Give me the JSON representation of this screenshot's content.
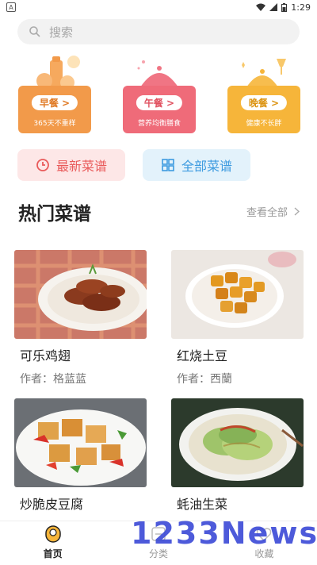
{
  "status_bar": {
    "time": "1:29",
    "left_icon": "A"
  },
  "search": {
    "placeholder": "搜索"
  },
  "meals": [
    {
      "label": "早餐 >",
      "subtitle": "365天不重样",
      "color": "#f29a4a"
    },
    {
      "label": "午餐 >",
      "subtitle": "营养均衡膳食",
      "color": "#ef6b79"
    },
    {
      "label": "晚餐 >",
      "subtitle": "健康不长胖",
      "color": "#f6b53a"
    }
  ],
  "quick_links": {
    "latest": "最新菜谱",
    "all": "全部菜谱"
  },
  "section": {
    "title": "热门菜谱",
    "view_all": "查看全部"
  },
  "recipes": [
    {
      "title": "可乐鸡翅",
      "author": "作者：格蓝蓝"
    },
    {
      "title": "红烧土豆",
      "author": "作者：西蘭"
    },
    {
      "title": "炒脆皮豆腐",
      "author": ""
    },
    {
      "title": "蚝油生菜",
      "author": ""
    }
  ],
  "tabs": [
    {
      "label": "首页",
      "active": true
    },
    {
      "label": "分类",
      "active": false
    },
    {
      "label": "收藏",
      "active": false
    }
  ],
  "watermark": "1233News"
}
